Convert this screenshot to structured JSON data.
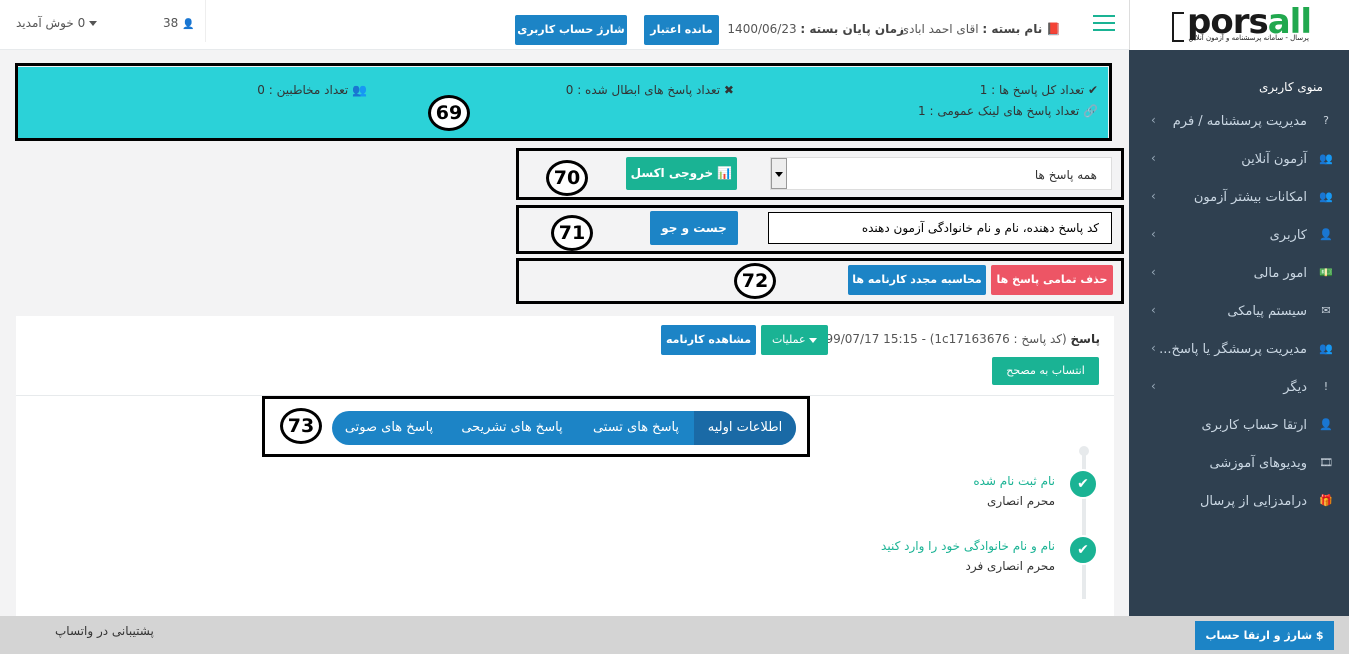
{
  "logo": {
    "text_dark": "pors",
    "text_green": "all",
    "subtitle": "پرسال - سامانه پرسشنامه و آزمون آنلاین"
  },
  "sidebar": {
    "title": "منوی کاربری",
    "items": [
      {
        "icon": "question-icon",
        "glyph": "?",
        "label": "مدیریت پرسشنامه / فرم",
        "has_chevron": true
      },
      {
        "icon": "users-icon",
        "glyph": "👥",
        "label": "آزمون آنلاین",
        "has_chevron": true
      },
      {
        "icon": "users-icon",
        "glyph": "👥",
        "label": "امکانات بیشتر آزمون",
        "has_chevron": true
      },
      {
        "icon": "user-icon",
        "glyph": "👤",
        "label": "کاربری",
        "has_chevron": true
      },
      {
        "icon": "money-icon",
        "glyph": "💵",
        "label": "امور مالی",
        "has_chevron": true
      },
      {
        "icon": "envelope-icon",
        "glyph": "✉",
        "label": "سیستم پیامکی",
        "has_chevron": true
      },
      {
        "icon": "users-icon",
        "glyph": "👥",
        "label": "مدیریت پرسشگر یا پاسخ...",
        "has_chevron": true
      },
      {
        "icon": "exclamation-icon",
        "glyph": "!",
        "label": "دیگر",
        "has_chevron": true
      },
      {
        "icon": "user-icon",
        "glyph": "👤",
        "label": "ارتقا حساب کاربری",
        "has_chevron": false
      },
      {
        "icon": "video-icon",
        "glyph": "🎞",
        "label": "ویدیوهای آموزشی",
        "has_chevron": false
      },
      {
        "icon": "gift-icon",
        "glyph": "🎁",
        "label": "درامدزایی از پرسال",
        "has_chevron": false
      }
    ]
  },
  "header": {
    "package_label": "نام بسته :",
    "package_value": "اقای احمد ابادی",
    "end_time_label": "زمان پایان بسته :",
    "end_time_value": "1400/06/23",
    "balance_button": "مانده اعتبار",
    "charge_button": "شارژ حساب کاربری",
    "user_count": "38",
    "welcome": "0 خوش آمدید"
  },
  "annotations": {
    "stats": "69",
    "filter": "70",
    "search": "71",
    "actions": "72",
    "tabs": "73"
  },
  "stats": {
    "total_label": "✔ تعداد کل پاسخ ها : 1",
    "cancelled_label": "✖ تعداد پاسخ های ابطال شده : 0",
    "audience_label": "👥 تعداد مخاطبین : 0",
    "public_link_label": "🔗 تعداد پاسخ های لینک عمومی : 1"
  },
  "filter": {
    "selected": "همه پاسخ ها",
    "excel_button": "خروجی اکسل"
  },
  "search": {
    "placeholder": "کد پاسخ دهنده، نام و نام خانوادگی آزمون دهنده",
    "button": "جست و جو"
  },
  "actions": {
    "delete_all": "حذف تمامی پاسخ ها",
    "recalculate": "محاسبه مجدد کارنامه ها"
  },
  "response": {
    "title": "پاسخ",
    "meta": "(کد پاسخ : 1c17163676) - 1399/07/17 15:15",
    "operations_button": "عملیات",
    "view_report_button": "مشاهده کارنامه",
    "assign_grader_button": "انتساب به مصحح"
  },
  "tabs": [
    {
      "label": "اطلاعات اولیه",
      "active": true
    },
    {
      "label": "پاسخ های تستی",
      "active": false
    },
    {
      "label": "پاسخ های تشریحی",
      "active": false
    },
    {
      "label": "پاسخ های صوتی",
      "active": false
    }
  ],
  "timeline": [
    {
      "question": "نام ثبت نام شده",
      "answer": "محرم انصاری"
    },
    {
      "question": "نام و نام خانوادگی خود را وارد کنید",
      "answer": "محرم انصاری فرد"
    }
  ],
  "footer": {
    "support": "پشتیبانی در واتساپ",
    "upgrade_button": "$ شارژ و ارتقا حساب کاربری"
  }
}
